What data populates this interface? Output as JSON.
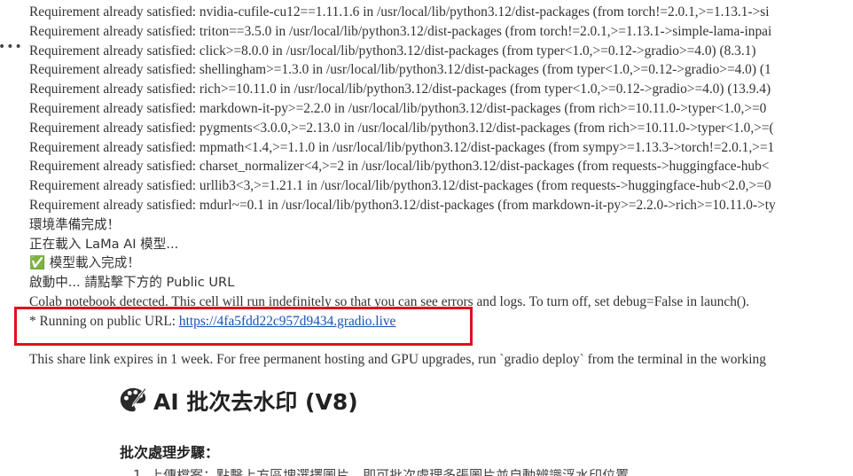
{
  "output_lines": [
    "Requirement already satisfied: nvidia-cufile-cu12==1.11.1.6 in /usr/local/lib/python3.12/dist-packages (from torch!=2.0.1,>=1.13.1->si",
    "Requirement already satisfied: triton==3.5.0 in /usr/local/lib/python3.12/dist-packages (from torch!=2.0.1,>=1.13.1->simple-lama-inpai",
    "Requirement already satisfied: click>=8.0.0 in /usr/local/lib/python3.12/dist-packages (from typer<1.0,>=0.12->gradio>=4.0) (8.3.1)",
    "Requirement already satisfied: shellingham>=1.3.0 in /usr/local/lib/python3.12/dist-packages (from typer<1.0,>=0.12->gradio>=4.0) (1",
    "Requirement already satisfied: rich>=10.11.0 in /usr/local/lib/python3.12/dist-packages (from typer<1.0,>=0.12->gradio>=4.0) (13.9.4)",
    "Requirement already satisfied: markdown-it-py>=2.2.0 in /usr/local/lib/python3.12/dist-packages (from rich>=10.11.0->typer<1.0,>=0",
    "Requirement already satisfied: pygments<3.0.0,>=2.13.0 in /usr/local/lib/python3.12/dist-packages (from rich>=10.11.0->typer<1.0,>=(",
    "Requirement already satisfied: mpmath<1.4,>=1.1.0 in /usr/local/lib/python3.12/dist-packages (from sympy>=1.13.3->torch!=2.0.1,>=1",
    "Requirement already satisfied: charset_normalizer<4,>=2 in /usr/local/lib/python3.12/dist-packages (from requests->huggingface-hub<",
    "Requirement already satisfied: urllib3<3,>=1.21.1 in /usr/local/lib/python3.12/dist-packages (from requests->huggingface-hub<2.0,>=0",
    "Requirement already satisfied: mdurl~=0.1 in /usr/local/lib/python3.12/dist-packages (from markdown-it-py>=2.2.0->rich>=10.11.0->ty"
  ],
  "status_lines": [
    "環境準備完成！",
    "正在載入 LaMa AI 模型...",
    "✅ 模型載入完成！",
    "啟動中... 請點擊下方的 Public URL"
  ],
  "colab_notice": "Colab notebook detected. This cell will run indefinitely so that you can see errors and logs. To turn off, set debug=False in launch().",
  "public_url_prefix": "* Running on public URL: ",
  "public_url": "https://4fa5fdd22c957d9434.gradio.live",
  "share_notice": "This share link expires in 1 week. For free permanent hosting and GPU upgrades, run `gradio deploy` from the terminal in the working",
  "app": {
    "title": "AI 批次去水印 (V8)",
    "title_icon": "palette-icon",
    "steps_heading": "批次處理步驟：",
    "cut_off_line": "1. 上傳檔案：點擊上方區塊選擇圖片，即可批次處理多張圖片並自動辨識浮水印位置"
  },
  "colors": {
    "highlight_border": "#e0101a",
    "link": "#1a4fb3",
    "text": "#333333"
  }
}
